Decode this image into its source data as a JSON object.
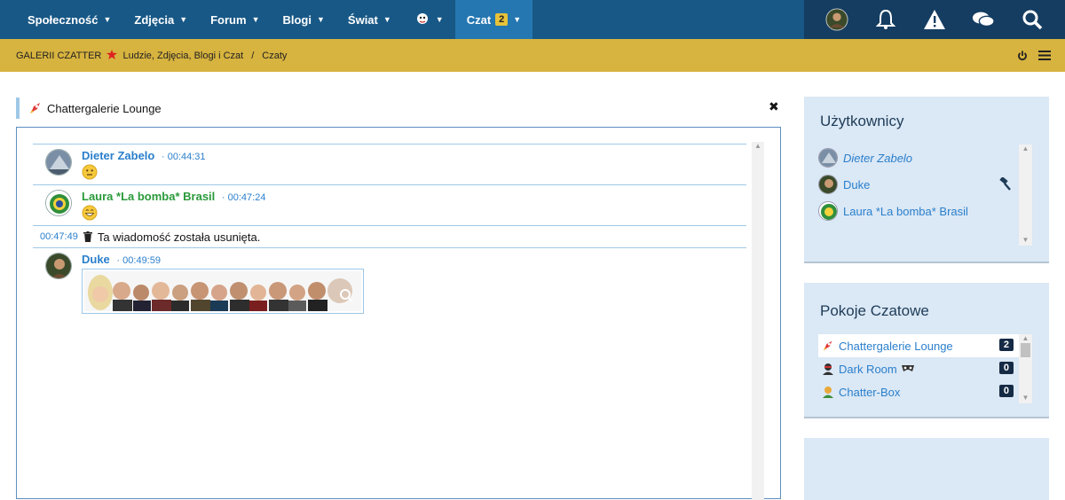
{
  "nav": {
    "items": [
      {
        "label": "Społeczność"
      },
      {
        "label": "Zdjęcia"
      },
      {
        "label": "Forum"
      },
      {
        "label": "Blogi"
      },
      {
        "label": "Świat"
      },
      {
        "label": ""
      },
      {
        "label": "Czat",
        "badge": "2"
      }
    ],
    "colors": {
      "bar": "#185886",
      "active": "#2577b1",
      "right": "#143d61"
    }
  },
  "breadcrumb": {
    "site": "GALERII CZATTER",
    "site_tagline": "Ludzie, Zdjęcia, Blogi i Czat",
    "sep": "/",
    "current": "Czaty"
  },
  "chat": {
    "room_title": "Chattergalerie Lounge",
    "messages": [
      {
        "user": "Dieter Zabelo",
        "dot": "·",
        "time": "00:44:31"
      },
      {
        "user": "Laura *La bomba* Brasil",
        "dot": "·",
        "time": "00:47:24"
      },
      {
        "time": "00:47:49",
        "text": "Ta wiadomość została usunięta."
      },
      {
        "user": "Duke",
        "dot": "·",
        "time": "00:49:59"
      }
    ]
  },
  "users_panel": {
    "title": "Użytkownicy",
    "users": [
      {
        "name": "Dieter Zabelo"
      },
      {
        "name": "Duke"
      },
      {
        "name": "Laura *La bomba* Brasil"
      }
    ]
  },
  "rooms_panel": {
    "title": "Pokoje Czatowe",
    "rooms": [
      {
        "name": "Chattergalerie Lounge",
        "count": "2"
      },
      {
        "name": "Dark Room",
        "count": "0"
      },
      {
        "name": "Chatter-Box",
        "count": "0"
      }
    ]
  }
}
